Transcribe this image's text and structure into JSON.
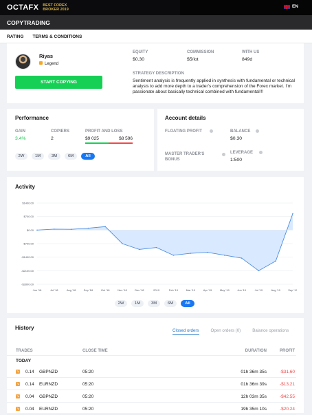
{
  "topbar": {
    "logo": "OCTAFX",
    "award_line1": "BEST FOREX",
    "award_line2": "BROKER 2019",
    "language": "EN"
  },
  "page": {
    "title": "COPYTRADING",
    "tabs": [
      "RATING",
      "TERMS & CONDITIONS"
    ]
  },
  "trader": {
    "name": "Riyas",
    "badge": "Legend",
    "start_button": "START COPYING",
    "stats": {
      "equity_label": "EQUITY",
      "equity_value": "$0.30",
      "commission_label": "COMMISSION",
      "commission_value": "$5/lot",
      "with_us_label": "WITH US",
      "with_us_value": "849d"
    },
    "strategy_label": "STRATEGY DESCRIPTION",
    "strategy_text": "Sentiment analysis is frequently applied in synthesis with fundamental or technical analysis to add more depth to a trader’s comprehension of the Forex market. I’m passionate about basically technical combined with fundamental!!!"
  },
  "performance": {
    "title": "Performance",
    "gain_label": "GAIN",
    "gain_value": "3.4%",
    "copiers_label": "COPIERS",
    "copiers_value": "2",
    "profit_loss_label": "PROFIT AND LOSS",
    "profit_value": "$9 025",
    "loss_value": "$8 596",
    "periods": [
      "2W",
      "1M",
      "3M",
      "6M",
      "All"
    ],
    "active_period": "All"
  },
  "account": {
    "title": "Account details",
    "floating_label": "FLOATING PROFIT",
    "balance_label": "BALANCE",
    "balance_value": "$0.30",
    "master_label": "MASTER TRADER'S BONUS",
    "leverage_label": "LEVERAGE",
    "leverage_value": "1:500"
  },
  "activity": {
    "title": "Activity",
    "periods": [
      "2W",
      "1M",
      "3M",
      "6M",
      "All"
    ],
    "active_period": "All"
  },
  "chart_data": {
    "type": "area",
    "title": "",
    "x": [
      "Jun '18",
      "Jul '18",
      "Aug '18",
      "Sep '18",
      "Oct '18",
      "Nov '18",
      "Dec '18",
      "2019",
      "Feb '19",
      "Mar '19",
      "Apr '19",
      "May '19",
      "Jun '19",
      "Jul '19",
      "Aug '19",
      "Sep '19"
    ],
    "y_ticks": [
      "$1400.00",
      "$700.00",
      "$0.00",
      "-$700.00",
      "-$1400.00",
      "-$2100.00",
      "-$2800.00"
    ],
    "ylim": [
      -2800,
      1400
    ],
    "series": [
      {
        "values": [
          0,
          50,
          40,
          100,
          180,
          -700,
          -1000,
          -900,
          -1300,
          -1200,
          -1150,
          -1300,
          -1450,
          -2100,
          -1600,
          850
        ]
      }
    ],
    "grid": true
  },
  "history": {
    "title": "History",
    "tabs": [
      "Closed orders",
      "Open orders (0)",
      "Balance operations"
    ],
    "active_tab": "Closed orders",
    "headers": [
      "TRADES",
      "CLOSE TIME",
      "DURATION",
      "PROFIT"
    ],
    "group": "TODAY",
    "rows": [
      {
        "volume": "0.14",
        "symbol": "GBPNZD",
        "time": "05:20",
        "duration": "01h 36m 35s",
        "profit": "-$31.60"
      },
      {
        "volume": "0.14",
        "symbol": "EURNZD",
        "time": "05:20",
        "duration": "01h 36m 39s",
        "profit": "-$13.21"
      },
      {
        "volume": "0.04",
        "symbol": "GBPNZD",
        "time": "05:20",
        "duration": "12h 03m 35s",
        "profit": "-$42.55"
      },
      {
        "volume": "0.04",
        "symbol": "EURNZD",
        "time": "05:20",
        "duration": "19h 35m 10s",
        "profit": "-$20.24"
      }
    ]
  },
  "colors": {
    "accent": "#1877f2",
    "green": "#16cf55",
    "red": "#f24747",
    "chart_line": "#4d8fe3",
    "chart_fill": "#d9e9ff"
  }
}
